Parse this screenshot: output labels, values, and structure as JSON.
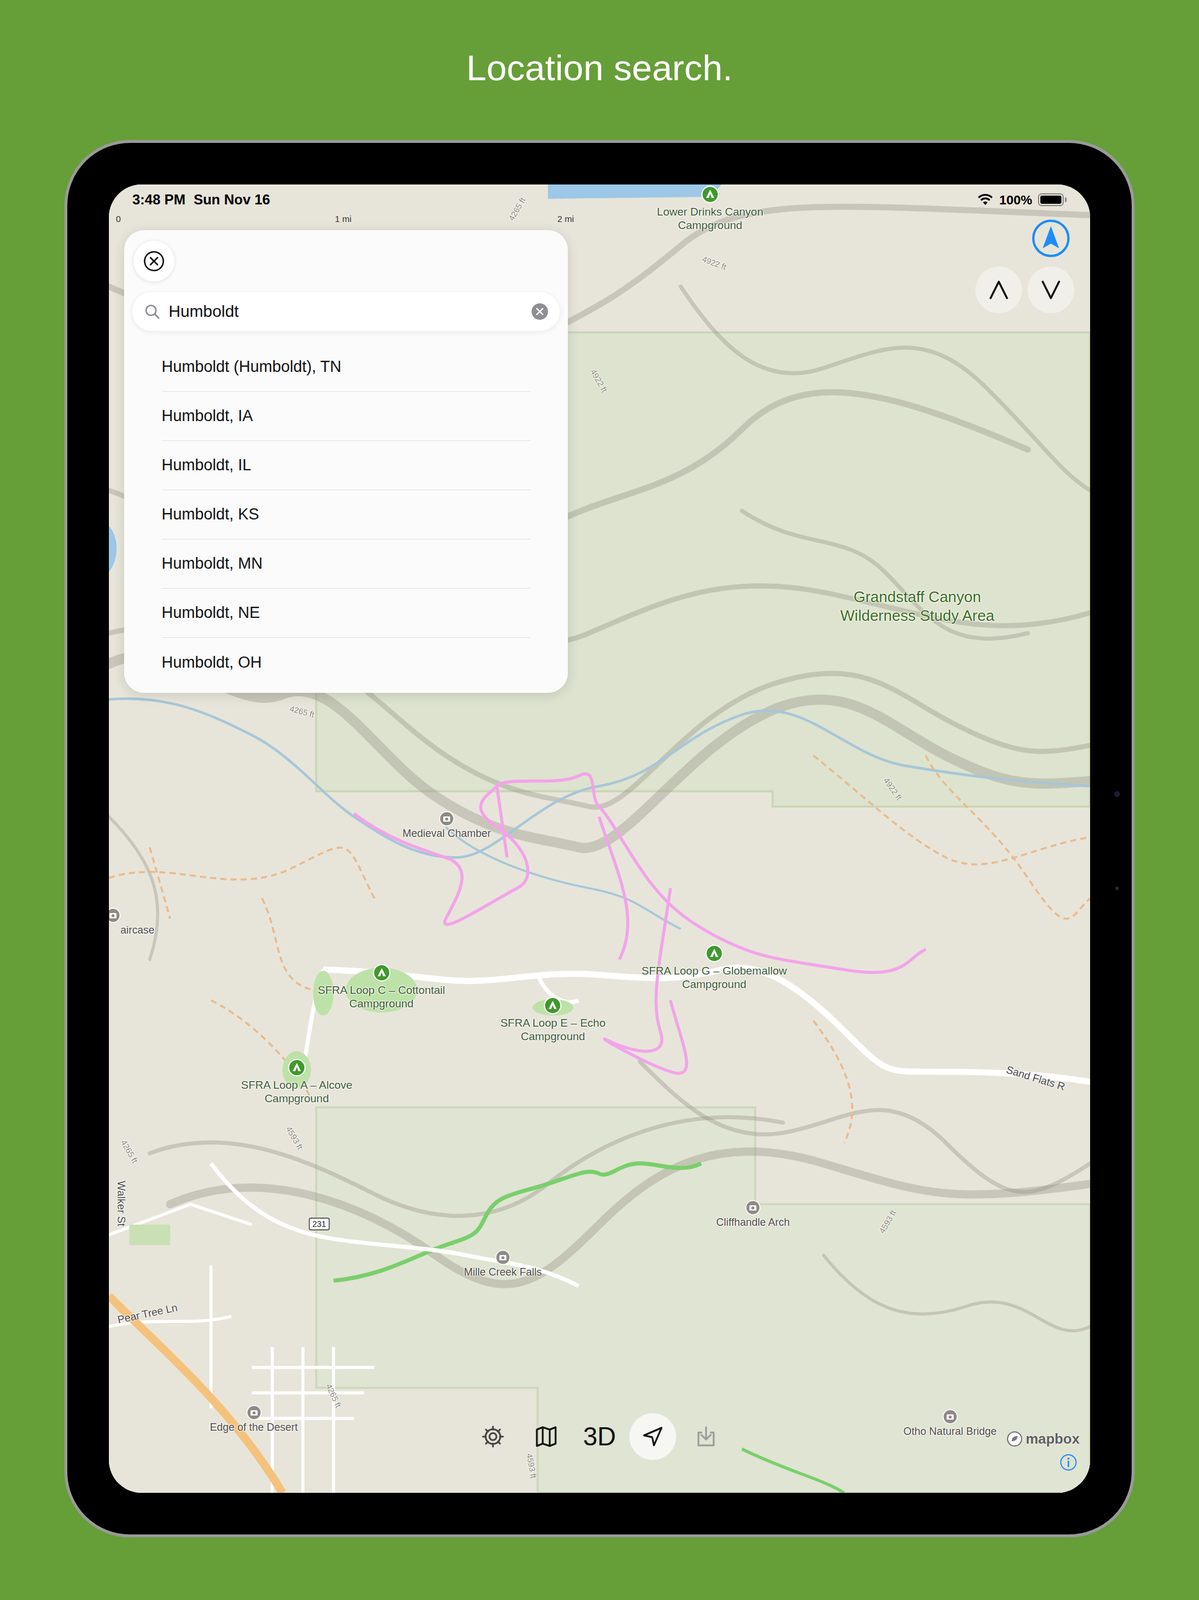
{
  "caption": "Location search.",
  "status_bar": {
    "time": "3:48 PM",
    "date": "Sun Nov 16",
    "wifi_on": true,
    "battery": "100%",
    "battery_level": 1
  },
  "scale_bar": {
    "ticks": [
      "0",
      "1 mi",
      "2 mi"
    ]
  },
  "search": {
    "query": "Humboldt",
    "results": [
      "Humboldt (Humboldt), TN",
      "Humboldt, IA",
      "Humboldt, IL",
      "Humboldt, KS",
      "Humboldt, MN",
      "Humboldt, NE",
      "Humboldt, OH"
    ]
  },
  "map_controls": {
    "tracking": true
  },
  "map": {
    "places": [
      {
        "label": "Lower Drinks Canyon Campground",
        "kind": "campground"
      },
      {
        "label": "Grandstaff Canyon Wilderness Study Area",
        "kind": "area"
      },
      {
        "label": "Medieval Chamber",
        "kind": "poi"
      },
      {
        "label": "SFRA Loop C – Cottontail Campground",
        "kind": "campground"
      },
      {
        "label": "SFRA Loop E – Echo Campground",
        "kind": "campground"
      },
      {
        "label": "SFRA Loop G – Globemallow Campground",
        "kind": "campground"
      },
      {
        "label": "SFRA Loop A – Alcove Campground",
        "kind": "campground"
      },
      {
        "label": "Cliffhandle Arch",
        "kind": "poi"
      },
      {
        "label": "Mille Creek Falls",
        "kind": "poi"
      },
      {
        "label": "Otho Natural Bridge",
        "kind": "poi"
      },
      {
        "label": "Edge of the Desert",
        "kind": "poi"
      },
      {
        "label": "aircase",
        "kind": "poi"
      },
      {
        "label": "Sand Flats R",
        "kind": "road"
      },
      {
        "label": "Walker St",
        "kind": "road"
      },
      {
        "label": "Pear Tree Ln",
        "kind": "road"
      },
      {
        "label": "231",
        "kind": "shield"
      },
      {
        "label": "4265 ft",
        "kind": "elevation"
      },
      {
        "label": "4922 ft",
        "kind": "elevation"
      },
      {
        "label": "4922 ft",
        "kind": "elevation"
      },
      {
        "label": "4265 ft",
        "kind": "elevation"
      },
      {
        "label": "4922 ft",
        "kind": "elevation"
      },
      {
        "label": "4265 ft",
        "kind": "elevation"
      },
      {
        "label": "4593 ft",
        "kind": "elevation"
      },
      {
        "label": "4593 ft",
        "kind": "elevation"
      },
      {
        "label": "4265 ft",
        "kind": "elevation"
      },
      {
        "label": "4593 ft",
        "kind": "elevation"
      }
    ]
  },
  "toolbar": {
    "mode_label": "3D",
    "locate_selected": true,
    "download_disabled": true
  },
  "attribution": {
    "logo": "mapbox"
  }
}
